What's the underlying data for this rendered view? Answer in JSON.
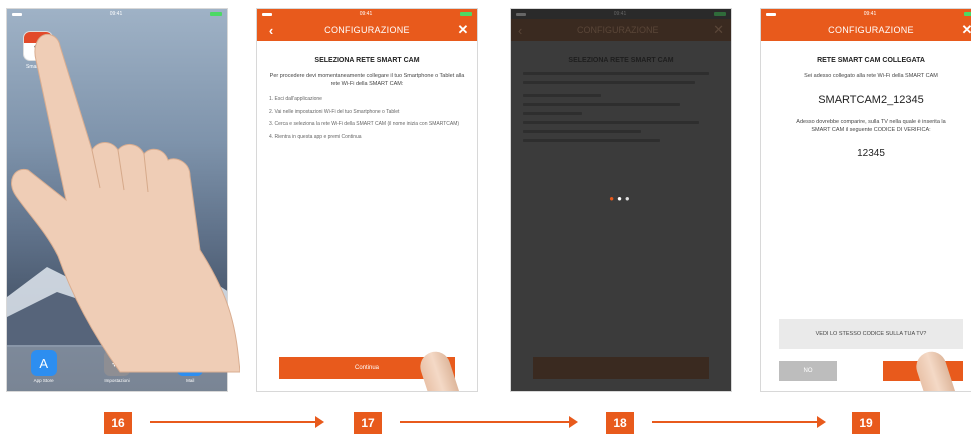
{
  "steps": [
    "16",
    "17",
    "18",
    "19"
  ],
  "colors": {
    "accent": "#e85a1c"
  },
  "screen16": {
    "status_time": "09:41",
    "app_label": "SmartCam",
    "dock": [
      {
        "label": "App Store",
        "icon": "app-store-icon",
        "color": "#2d8ef0"
      },
      {
        "label": "Impostazioni",
        "icon": "settings-icon",
        "color": "#8e8e93"
      },
      {
        "label": "Mail",
        "icon": "mail-icon",
        "color": "#2d8ef0",
        "badge": "1"
      }
    ]
  },
  "screen17": {
    "status_time": "09:41",
    "title": "CONFIGURAZIONE",
    "heading": "SELEZIONA RETE SMART CAM",
    "intro": "Per procedere devi momentaneamente collegare il tuo Smartphone o Tablet alla rete Wi-Fi della SMART CAM:",
    "steps": [
      "1. Esci dall'applicazione",
      "2. Vai nelle impostazioni Wi-Fi del tuo Smartphone o Tablet",
      "3. Cerca e seleziona la rete Wi-Fi della SMART CAM (il nome inizia con SMARTCAM)",
      "4. Rientra in questa app e premi Continua"
    ],
    "button": "Continua"
  },
  "screen18": {
    "status_time": "09:41",
    "title": "CONFIGURAZIONE",
    "heading": "SELEZIONA RETE SMART CAM"
  },
  "screen19": {
    "status_time": "09:41",
    "title": "CONFIGURAZIONE",
    "heading": "RETE SMART CAM COLLEGATA",
    "connected_text": "Sei adesso collegato alla rete Wi-Fi della SMART CAM",
    "ssid": "SMARTCAM2_12345",
    "instruction": "Adesso dovrebbe comparire, sulla TV nella quale è inserita la SMART CAM il seguente CODICE DI VERIFICA:",
    "code": "12345",
    "question": "VEDI LO STESSO CODICE SULLA TUA TV?",
    "no": "NO",
    "yes": "SI"
  }
}
